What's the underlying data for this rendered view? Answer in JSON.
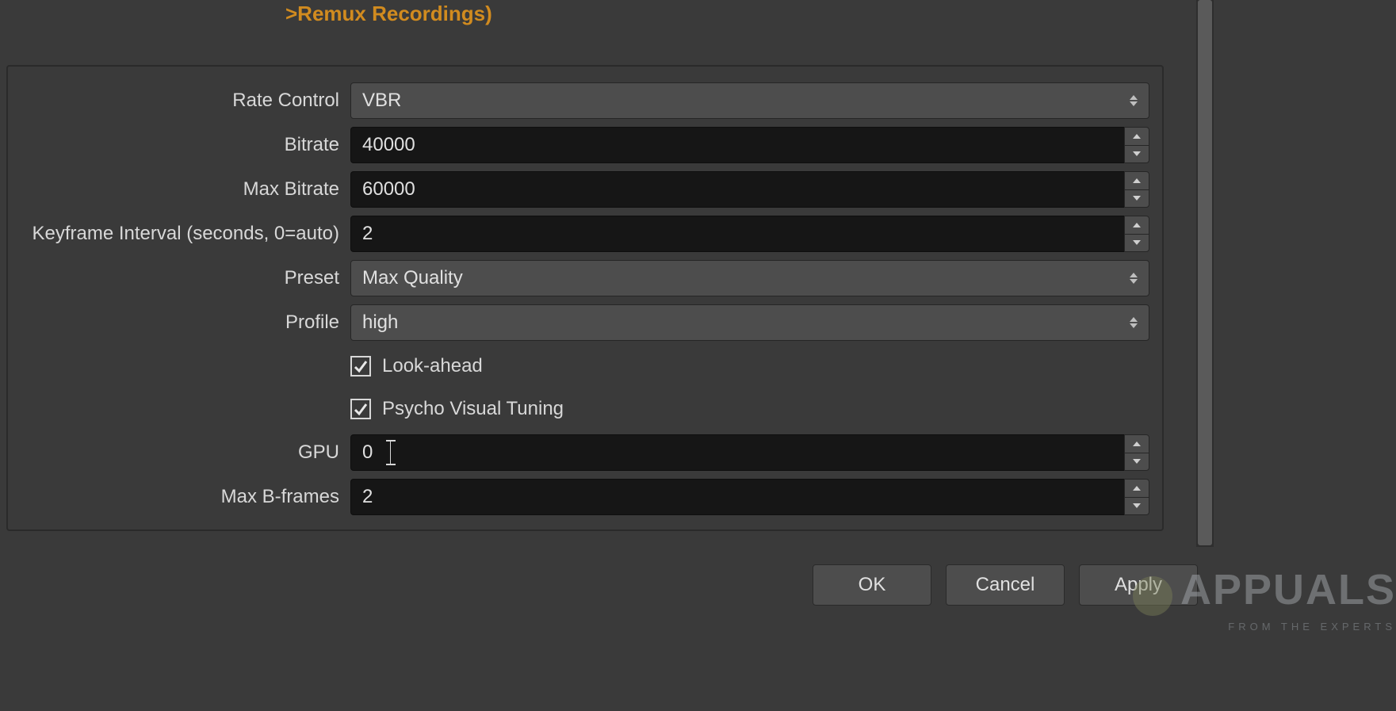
{
  "header": {
    "warning": ">Remux Recordings)"
  },
  "settings": {
    "rate_control": {
      "label": "Rate Control",
      "value": "VBR"
    },
    "bitrate": {
      "label": "Bitrate",
      "value": "40000"
    },
    "max_bitrate": {
      "label": "Max Bitrate",
      "value": "60000"
    },
    "keyframe": {
      "label": "Keyframe Interval (seconds, 0=auto)",
      "value": "2"
    },
    "preset": {
      "label": "Preset",
      "value": "Max Quality"
    },
    "profile": {
      "label": "Profile",
      "value": "high"
    },
    "look_ahead": {
      "label": "Look-ahead",
      "checked": true
    },
    "psycho": {
      "label": "Psycho Visual Tuning",
      "checked": true
    },
    "gpu": {
      "label": "GPU",
      "value": "0"
    },
    "max_bframes": {
      "label": "Max B-frames",
      "value": "2"
    }
  },
  "buttons": {
    "ok": "OK",
    "cancel": "Cancel",
    "apply": "Apply"
  },
  "watermark": {
    "brand": "APPUALS",
    "tagline": "FROM THE EXPERTS"
  }
}
